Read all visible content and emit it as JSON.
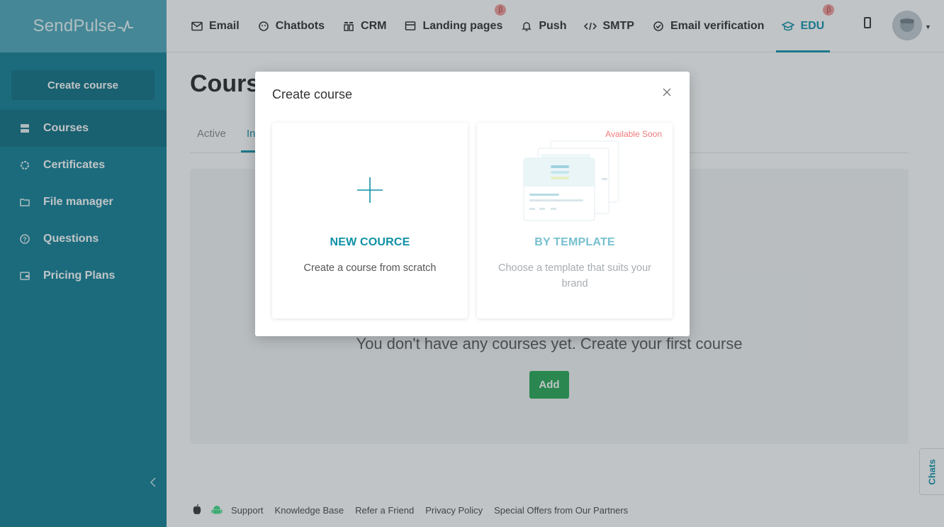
{
  "app": {
    "brand": "SendPulse"
  },
  "sidebar": {
    "create_button": "Create course",
    "items": [
      {
        "label": "Courses",
        "icon": "courses-icon",
        "active": true
      },
      {
        "label": "Certificates",
        "icon": "certificate-icon",
        "active": false
      },
      {
        "label": "File manager",
        "icon": "folder-icon",
        "active": false
      },
      {
        "label": "Questions",
        "icon": "question-icon",
        "active": false
      },
      {
        "label": "Pricing Plans",
        "icon": "wallet-icon",
        "active": false
      }
    ]
  },
  "topnav": {
    "items": [
      {
        "label": "Email",
        "icon": "envelope-icon",
        "beta": false
      },
      {
        "label": "Chatbots",
        "icon": "chatbot-icon",
        "beta": false
      },
      {
        "label": "CRM",
        "icon": "crm-icon",
        "beta": false
      },
      {
        "label": "Landing pages",
        "icon": "landing-icon",
        "beta": true
      },
      {
        "label": "Push",
        "icon": "bell-icon",
        "beta": false
      },
      {
        "label": "SMTP",
        "icon": "code-icon",
        "beta": false
      },
      {
        "label": "Email verification",
        "icon": "check-circle-icon",
        "beta": false
      },
      {
        "label": "EDU",
        "icon": "graduation-cap-icon",
        "beta": true,
        "active": true
      }
    ],
    "beta_symbol": "β"
  },
  "page": {
    "title": "Courses",
    "tabs": [
      "Active",
      "In"
    ],
    "empty_message": "You don't have any courses yet. Create your first course",
    "add_button": "Add"
  },
  "footer": {
    "links": [
      "Support",
      "Knowledge Base",
      "Refer a Friend",
      "Privacy Policy",
      "Special Offers from Our Partners"
    ]
  },
  "chats_tab": "Chats",
  "modal": {
    "title": "Create course",
    "cards": [
      {
        "heading": "NEW COURCE",
        "description": "Create a course from scratch"
      },
      {
        "heading": "BY TEMPLATE",
        "description": "Choose a template that suits your brand",
        "badge": "Available Soon"
      }
    ]
  },
  "colors": {
    "sidebar": "#0d7d94",
    "accent": "#0e90a8",
    "add_button": "#23a651",
    "badge_text": "#f07a7a"
  }
}
